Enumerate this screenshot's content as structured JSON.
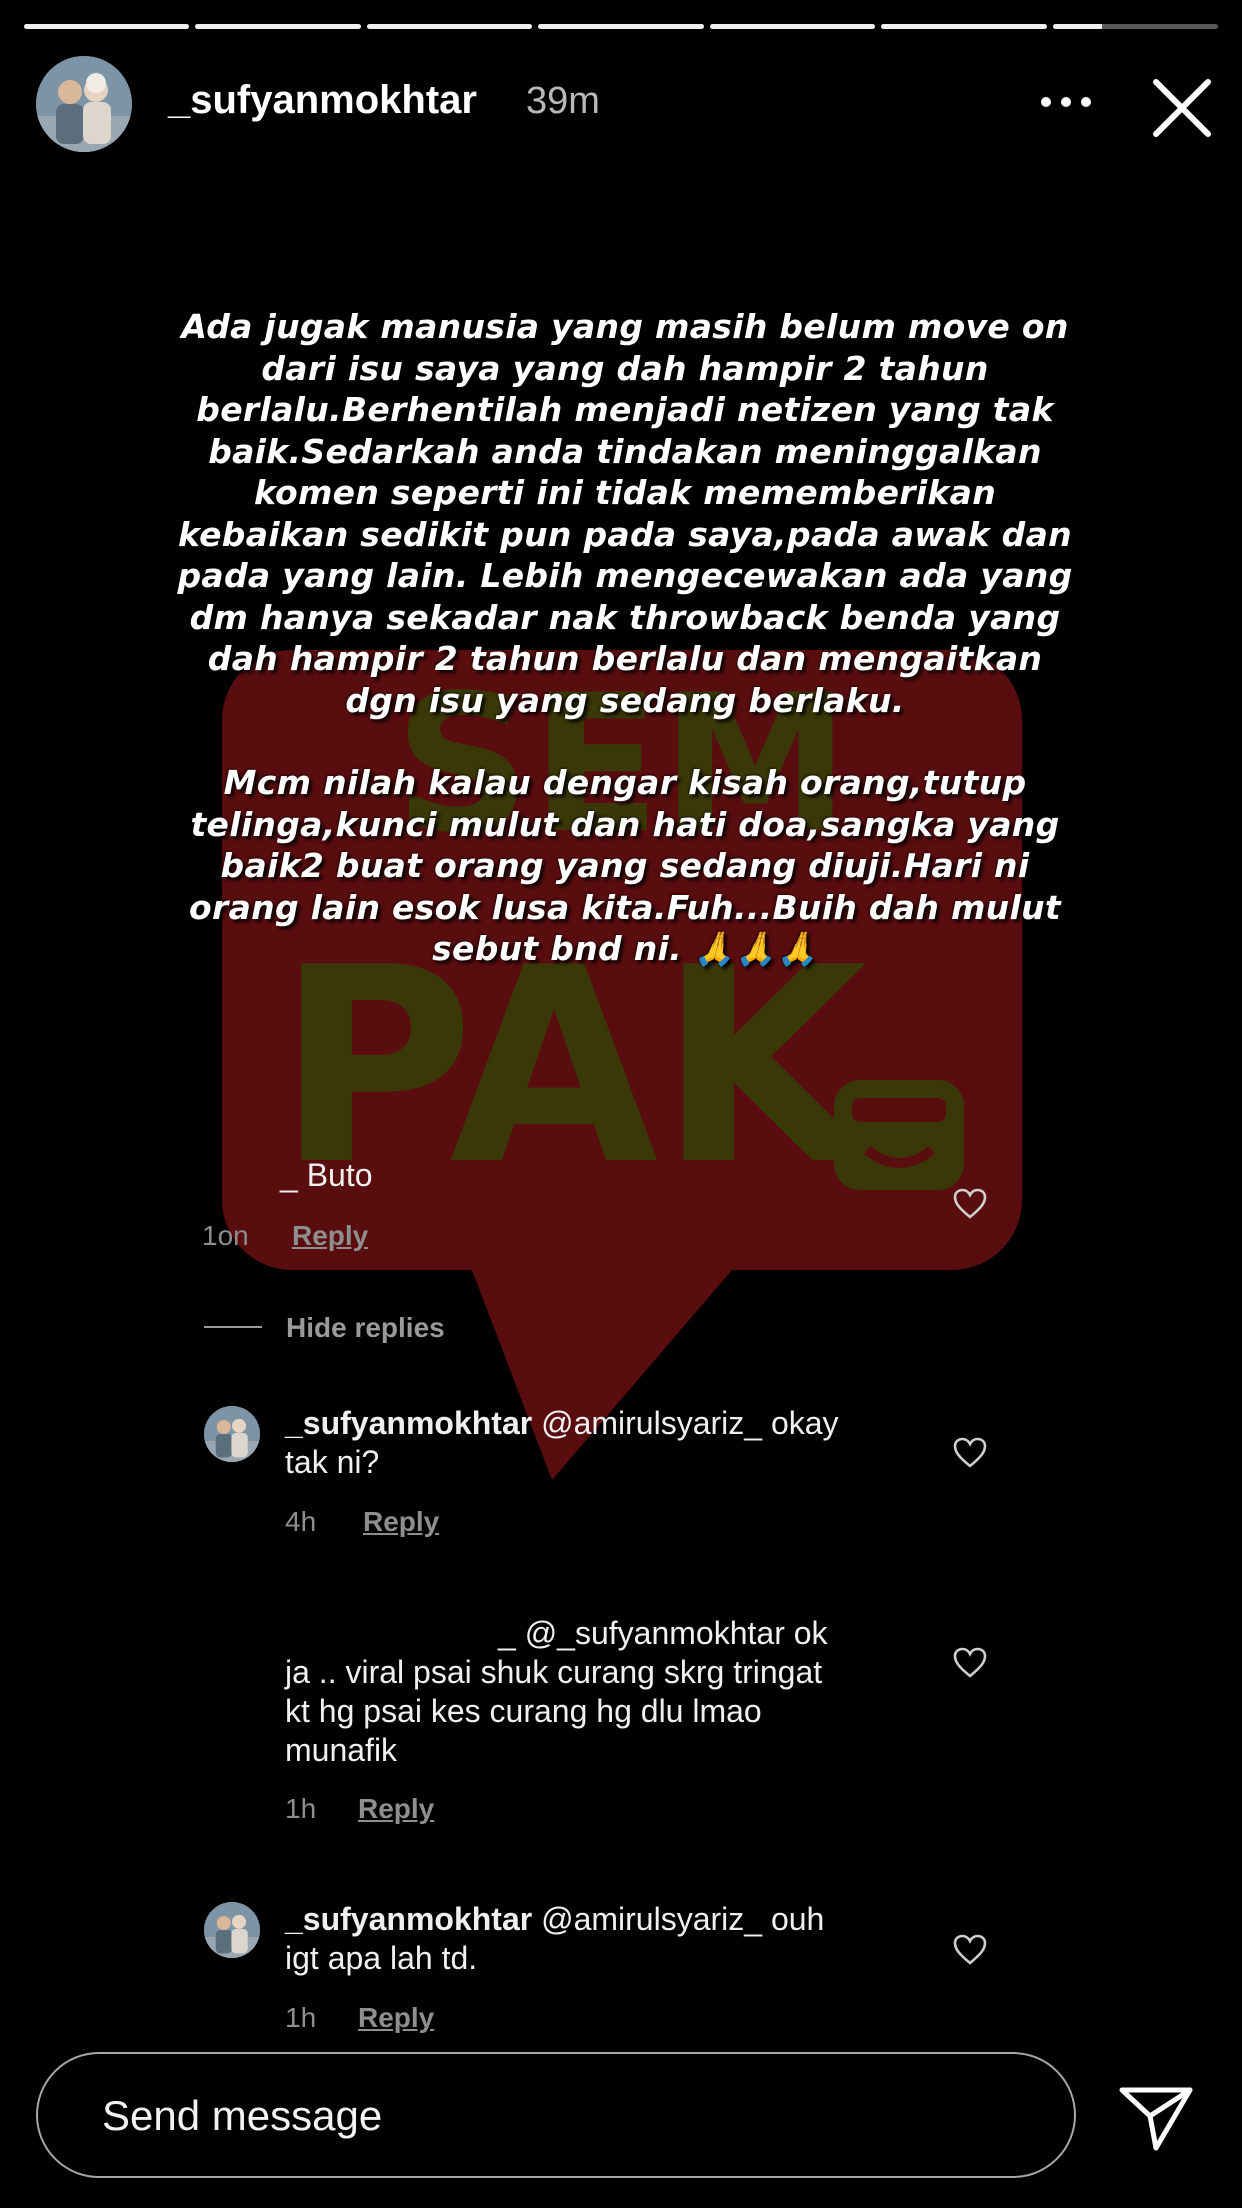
{
  "story": {
    "progress_segments": [
      1,
      1,
      1,
      1,
      1,
      1,
      0.3
    ],
    "header": {
      "username": "_sufyanmokhtar",
      "time": "39m",
      "more_icon": "more-horizontal-icon",
      "close_icon": "close-icon"
    },
    "caption": {
      "paragraph_1": "Ada jugak manusia yang masih belum move on\ndari isu saya yang dah hampir 2 tahun\nberlalu.Berhentilah menjadi netizen yang tak\nbaik.Sedarkah anda tindakan meninggalkan\nkomen seperti ini tidak mememberikan\nkebaikan sedikit pun pada saya,pada awak dan\npada yang lain. Lebih mengecewakan ada yang\ndm hanya sekadar nak throwback benda yang\ndah hampir 2 tahun berlalu dan mengaitkan\ndgn isu yang sedang berlaku.",
      "paragraph_2": "Mcm nilah kalau dengar kisah orang,tutup\ntelinga,kunci mulut dan hati doa,sangka yang\nbaik2 buat orang yang sedang diuji.Hari ni\norang lain esok lusa kita.Fuh...Buih dah mulut\nsebut bnd ni. 🙏🙏🙏"
    },
    "watermark": {
      "top_text": "SEM",
      "bottom_text": "PAK",
      "colors": {
        "box": "#5a0d0f",
        "text": "#3a3808"
      }
    },
    "comments": [
      {
        "username": "",
        "text": "_ Buto",
        "time": "1on",
        "reply_label": "Reply"
      },
      {
        "hide_replies_label": "Hide replies"
      },
      {
        "username": "_sufyanmokhtar",
        "text_line_1": "@amirulsyariz_ okay",
        "text_line_2": "tak ni?",
        "time": "4h",
        "reply_label": "Reply"
      },
      {
        "username": "",
        "text_line_1": "_ @_sufyanmokhtar ok",
        "text_line_2": "ja .. viral psai shuk curang skrg tringat",
        "text_line_3": "kt hg psai kes curang hg dlu lmao",
        "text_line_4": "munafik",
        "time": "1h",
        "reply_label": "Reply"
      },
      {
        "username": "_sufyanmokhtar",
        "text_line_1": "@amirulsyariz_ ouh",
        "text_line_2": "igt apa lah td.",
        "time": "1h",
        "reply_label": "Reply"
      }
    ],
    "footer": {
      "send_placeholder": "Send message",
      "send_icon": "send-icon"
    }
  }
}
